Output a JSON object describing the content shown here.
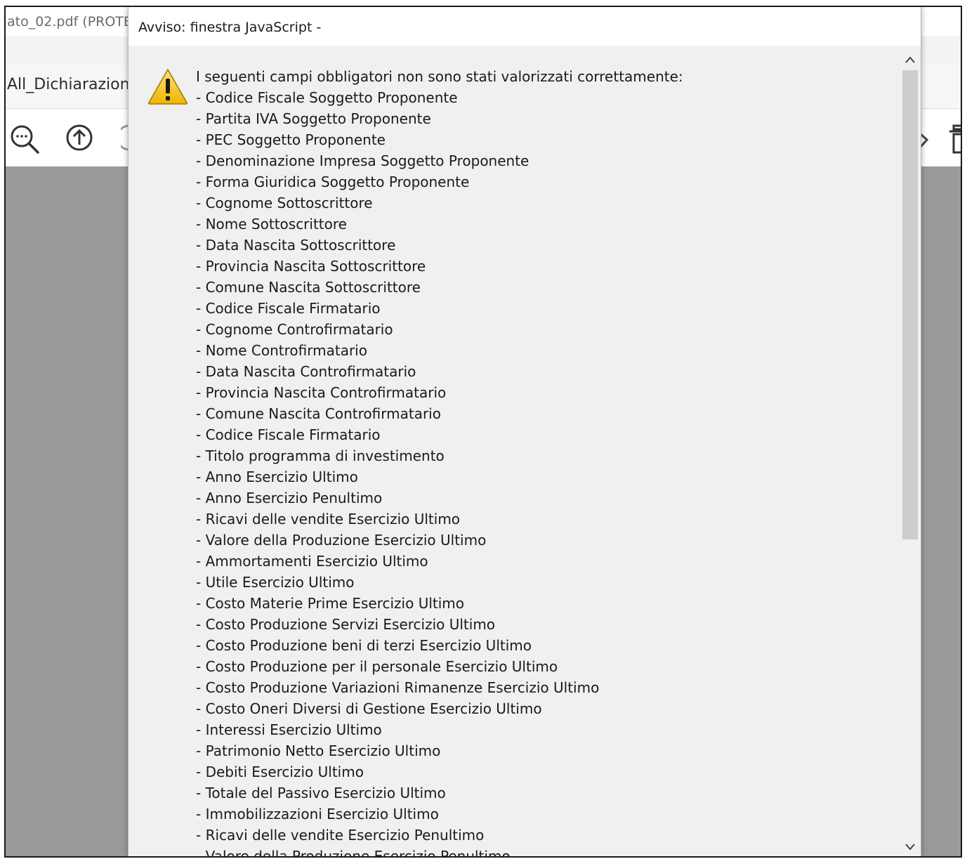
{
  "background_window": {
    "title": "ato_02.pdf (PROTE",
    "tab_label": "All_Dichiarazion"
  },
  "dialog": {
    "title": "Avviso: finestra JavaScript -",
    "message_lines": [
      "I seguenti campi obbligatori non sono stati valorizzati correttamente:",
      "- Codice Fiscale Soggetto Proponente",
      "- Partita IVA Soggetto Proponente",
      "- PEC Soggetto Proponente",
      "- Denominazione Impresa Soggetto Proponente",
      "- Forma Giuridica Soggetto Proponente",
      "- Cognome Sottoscrittore",
      "- Nome Sottoscrittore",
      "- Data Nascita Sottoscrittore",
      "- Provincia Nascita Sottoscrittore",
      "- Comune Nascita Sottoscrittore",
      "- Codice Fiscale Firmatario",
      "- Cognome Controfirmatario",
      "- Nome Controfirmatario",
      "- Data Nascita Controfirmatario",
      "- Provincia Nascita Controfirmatario",
      "- Comune Nascita Controfirmatario",
      "- Codice Fiscale Firmatario",
      "- Titolo programma di investimento",
      "- Anno Esercizio Ultimo",
      "- Anno Esercizio Penultimo",
      "- Ricavi delle vendite Esercizio Ultimo",
      "- Valore della Produzione Esercizio Ultimo",
      "- Ammortamenti Esercizio Ultimo",
      "- Utile Esercizio Ultimo",
      "- Costo Materie Prime Esercizio Ultimo",
      "- Costo Produzione Servizi Esercizio Ultimo",
      "- Costo Produzione beni di terzi Esercizio Ultimo",
      "- Costo Produzione per il personale Esercizio Ultimo",
      "- Costo Produzione Variazioni Rimanenze Esercizio Ultimo",
      "- Costo Oneri Diversi di Gestione Esercizio Ultimo",
      "- Interessi Esercizio Ultimo",
      "- Patrimonio Netto Esercizio Ultimo",
      "- Debiti Esercizio Ultimo",
      "- Totale del Passivo Esercizio Ultimo",
      "- Immobilizzazioni Esercizio Ultimo",
      "- Ricavi delle vendite Esercizio Penultimo",
      "- Valore della Produzione Esercizio Penultimo"
    ]
  },
  "icons": {
    "warning": "warning-icon",
    "zoom": "zoom-icon",
    "page_up": "arrow-up-circle-icon",
    "scroll_up": "chevron-up-icon",
    "scroll_down": "chevron-down-icon"
  },
  "colors": {
    "dialog_bg": "#f0f0f0",
    "canvas_bg": "#9a9a9a",
    "warning_yellow": "#f5c518"
  }
}
